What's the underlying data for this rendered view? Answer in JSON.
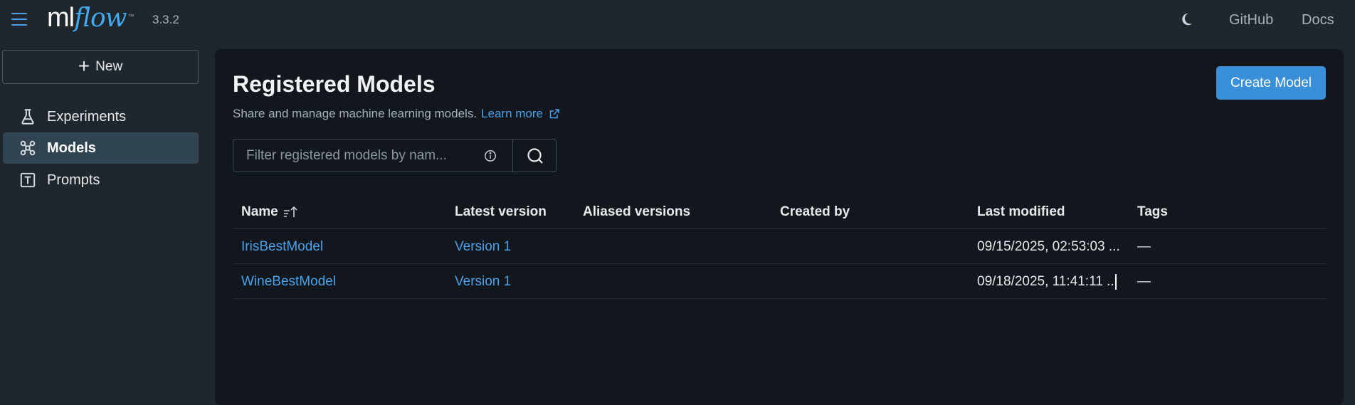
{
  "app": {
    "logo_ml": "ml",
    "logo_flow": "flow",
    "logo_tm": "™",
    "version": "3.3.2"
  },
  "topnav": {
    "theme_icon": "moon-icon",
    "github": "GitHub",
    "docs": "Docs"
  },
  "sidebar": {
    "new_label": "New",
    "items": [
      {
        "label": "Experiments",
        "icon": "flask-icon",
        "active": false
      },
      {
        "label": "Models",
        "icon": "models-icon",
        "active": true
      },
      {
        "label": "Prompts",
        "icon": "prompt-icon",
        "active": false
      }
    ]
  },
  "main": {
    "title": "Registered Models",
    "subtitle": "Share and manage machine learning models.",
    "learn_more": "Learn more",
    "create_button": "Create Model",
    "search": {
      "placeholder": "Filter registered models by nam...",
      "value": ""
    },
    "columns": [
      "Name",
      "Latest version",
      "Aliased versions",
      "Created by",
      "Last modified",
      "Tags"
    ],
    "rows": [
      {
        "name": "IrisBestModel",
        "latest_version": "Version 1",
        "aliased_versions": "",
        "created_by": "",
        "last_modified": "09/15/2025, 02:53:03 ...",
        "tags": "—"
      },
      {
        "name": "WineBestModel",
        "latest_version": "Version 1",
        "aliased_versions": "",
        "created_by": "",
        "last_modified": "09/18/2025, 11:41:11 ..",
        "tags": "—"
      }
    ]
  },
  "colors": {
    "accent": "#4aa1ea",
    "primary_button": "#3a8fd9",
    "background": "#1f272d",
    "panel": "#11171c",
    "active_nav": "#314452"
  }
}
